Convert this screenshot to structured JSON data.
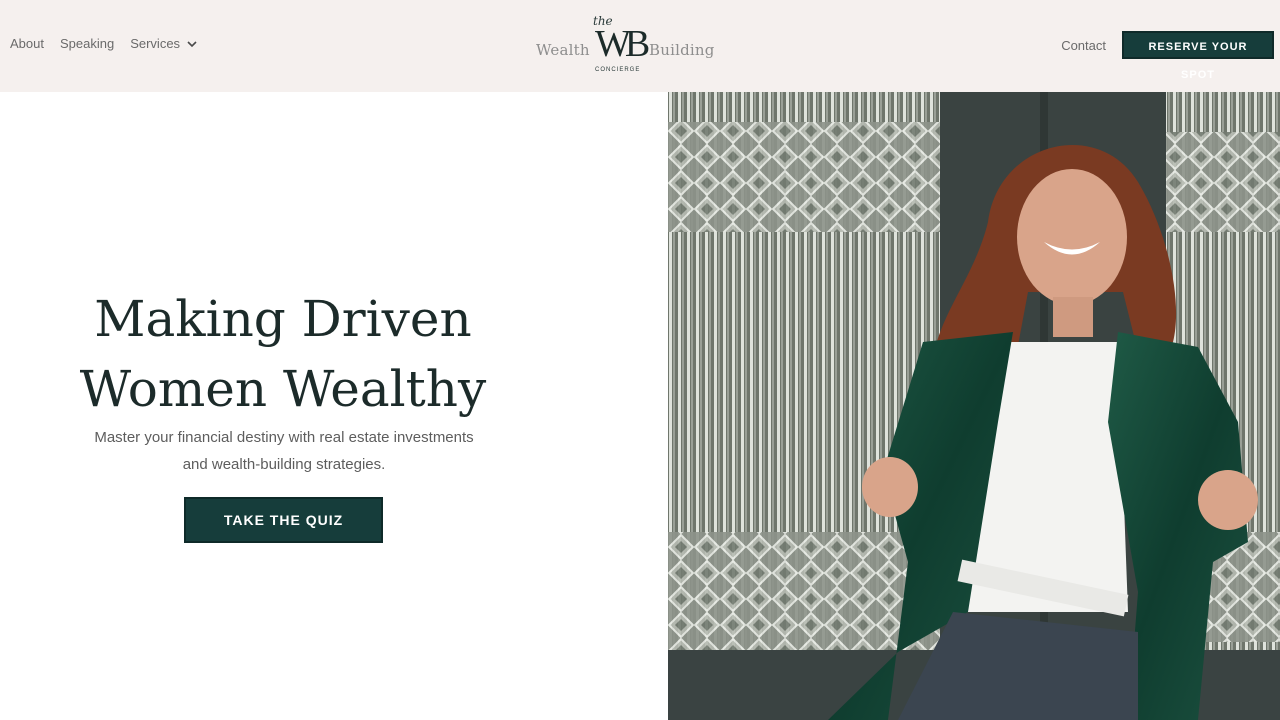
{
  "nav": {
    "left": [
      {
        "label": "About"
      },
      {
        "label": "Speaking"
      },
      {
        "label": "Services"
      }
    ],
    "contact_label": "Contact",
    "cta_label": "RESERVE YOUR SPOT"
  },
  "logo": {
    "word_left": "Wealth",
    "word_right": "Building",
    "the": "the",
    "monogram": "WB",
    "sub": "CONCIERGE"
  },
  "hero": {
    "title_line1": "Making Driven",
    "title_line2": "Women Wealthy",
    "subtitle_line1": "Master your financial destiny with real estate investments",
    "subtitle_line2": "and wealth-building strategies.",
    "cta_label": "TAKE THE QUIZ"
  },
  "colors": {
    "header_bg": "#f5f0ee",
    "brand_dark_green": "#163d3b",
    "text_dark": "#1c2b2a",
    "text_muted": "#5d5d5d"
  },
  "icons": {
    "services_dropdown": "chevron-down-icon"
  }
}
